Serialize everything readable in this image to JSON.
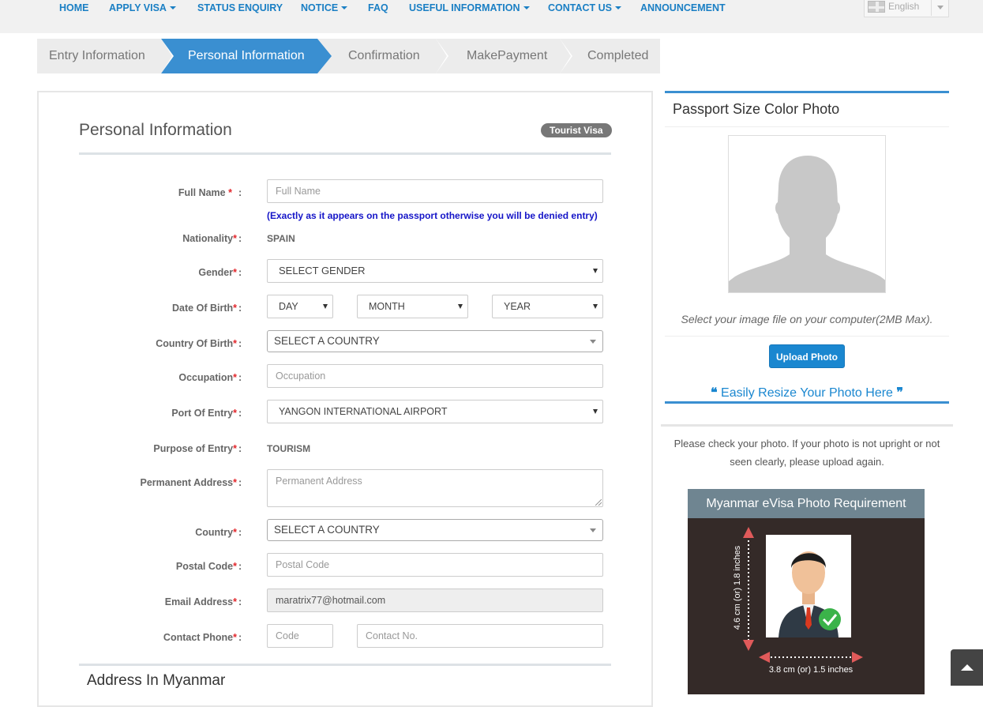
{
  "nav": {
    "items": [
      {
        "label": "HOME",
        "caret": false
      },
      {
        "label": "APPLY VISA",
        "caret": true
      },
      {
        "label": "STATUS ENQUIRY",
        "caret": false
      },
      {
        "label": "NOTICE",
        "caret": true
      },
      {
        "label": "FAQ",
        "caret": false
      },
      {
        "label": "USEFUL INFORMATION",
        "caret": true
      },
      {
        "label": "CONTACT US",
        "caret": true
      },
      {
        "label": "ANNOUNCEMENT",
        "caret": false
      }
    ],
    "language": "English"
  },
  "steps": [
    "Entry Information",
    "Personal Information",
    "Confirmation",
    "MakePayment",
    "Completed"
  ],
  "active_step": "Personal Information",
  "form": {
    "title": "Personal Information",
    "badge": "Tourist Visa",
    "full_name": {
      "label": "Full Name",
      "placeholder": "Full Name"
    },
    "passport_note": "(Exactly as it appears on the passport otherwise you will be denied entry)",
    "nationality": {
      "label": "Nationality",
      "value": "SPAIN"
    },
    "gender": {
      "label": "Gender",
      "value": "SELECT GENDER"
    },
    "dob": {
      "label": "Date Of Birth",
      "day": "DAY",
      "month": "MONTH",
      "year": "YEAR"
    },
    "country_of_birth": {
      "label": "Country Of Birth",
      "value": "SELECT A COUNTRY"
    },
    "occupation": {
      "label": "Occupation",
      "placeholder": "Occupation"
    },
    "port_of_entry": {
      "label": "Port Of Entry",
      "value": "YANGON INTERNATIONAL AIRPORT"
    },
    "purpose": {
      "label": "Purpose of Entry",
      "value": "TOURISM"
    },
    "address": {
      "label": "Permanent Address",
      "placeholder": "Permanent Address"
    },
    "country": {
      "label": "Country",
      "value": "SELECT A COUNTRY"
    },
    "postal_code": {
      "label": "Postal Code",
      "placeholder": "Postal Code"
    },
    "email": {
      "label": "Email Address",
      "value": "maratrix77@hotmail.com"
    },
    "phone": {
      "label": "Contact Phone",
      "code_placeholder": "Code",
      "number_placeholder": "Contact No."
    },
    "required_mark": "*",
    "colon": ":",
    "next_section": "Address In Myanmar"
  },
  "photo": {
    "title": "Passport Size Color Photo",
    "hint": "Select your image file on your computer(2MB Max).",
    "upload_button": "Upload Photo",
    "resize_link": "Easily Resize Your Photo Here",
    "check_text": "Please check your photo. If your photo is not upright or not seen clearly, please upload again.",
    "requirement_title": "Myanmar eVisa Photo Requirement",
    "height_text": "4.6 cm (or) 1.8 inches",
    "width_text": "3.8 cm (or) 1.5 inches"
  }
}
